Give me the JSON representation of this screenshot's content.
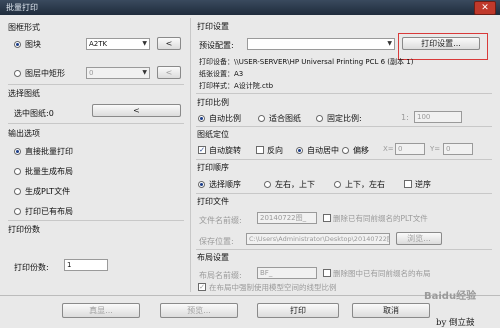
{
  "window": {
    "title": "批量打印",
    "close": "✕"
  },
  "drawing_form": {
    "heading": "图框形式",
    "block_label": "图块",
    "block_value": "A2TK",
    "block_pick": "<",
    "layer_rect_label": "图层中矩形",
    "layer_value": "0",
    "layer_pick": "<"
  },
  "select_drawings": {
    "heading": "选择图纸",
    "selected_label": "选中图纸:0",
    "pick": "<"
  },
  "output_options": {
    "heading": "输出选项",
    "items": [
      "直接批量打印",
      "批量生成布局",
      "生成PLT文件",
      "打印已有布局"
    ]
  },
  "copies": {
    "heading": "打印份数",
    "label": "打印份数:",
    "value": "1"
  },
  "print_settings": {
    "heading": "打印设置",
    "preset_label": "预设配置:",
    "preset_value": "",
    "settings_button": "打印设置...",
    "device": "打印设备：\\\\USER-SERVER\\HP Universal Printing PCL 6 (副本 1)",
    "paper": "纸张设置：A3",
    "style": "打印样式：A设计院.ctb"
  },
  "scale": {
    "heading": "打印比例",
    "options": [
      "自动比例",
      "适合图纸",
      "固定比例:"
    ],
    "prefix": "1:",
    "value": "100"
  },
  "position": {
    "heading": "图纸定位",
    "auto_rotate": "自动旋转",
    "reverse": "反向",
    "auto_center": "自动居中",
    "offset": "偏移",
    "x_label": "X=",
    "x_value": "0",
    "y_label": "Y=",
    "y_value": "0"
  },
  "order": {
    "heading": "打印顺序",
    "options": [
      "选择顺序",
      "左右，上下",
      "上下，左右"
    ],
    "reverse": "逆序"
  },
  "print_file": {
    "heading": "打印文件",
    "name_label": "文件名前缀:",
    "name_value": "20140722图_",
    "delete_same": "删除已有同前缀名的PLT文件",
    "save_label": "保存位置:",
    "save_value": "C:\\Users\\Administrator\\Desktop\\20140722图",
    "browse": "浏览..."
  },
  "layout": {
    "heading": "布局设置",
    "name_label": "布局名前缀:",
    "name_value": "BF_",
    "delete_same": "删除图中已有同前缀名的布局",
    "use_modelspace": "在布局中强制使用模型空间的线型比例"
  },
  "footer": {
    "preview_small": "真显...",
    "preview": "预览...",
    "print": "打印",
    "cancel": "取消",
    "watermark": "by 倒立鼓",
    "baidu": "Baidu经验"
  },
  "colors": {
    "highlight": "#d93a3a",
    "checked": "#1d3f8a"
  }
}
